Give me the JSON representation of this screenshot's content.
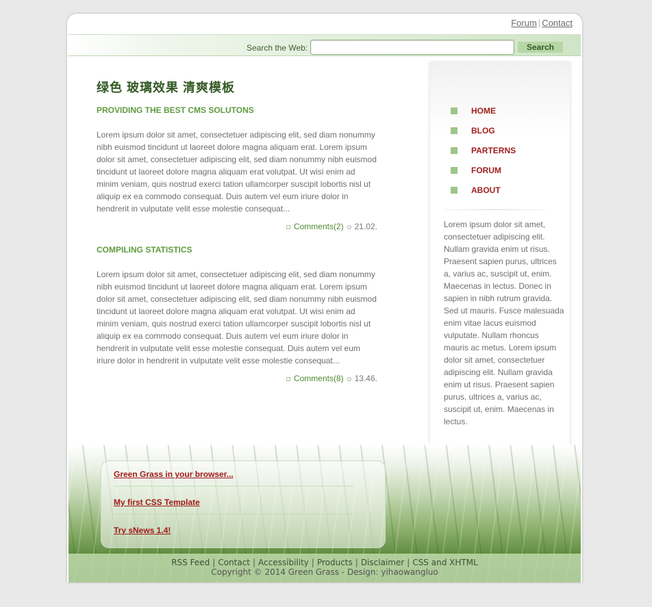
{
  "header": {
    "links": [
      {
        "label": "Forum"
      },
      {
        "label": "Contact"
      }
    ],
    "separator": "|",
    "search": {
      "label": "Search the Web:",
      "button": "Search",
      "value": ""
    }
  },
  "main": {
    "title": "绿色 玻璃效果 清爽模板",
    "posts": [
      {
        "title": "PROVIDING THE BEST CMS SOLUTONS",
        "body": "Lorem ipsum dolor sit amet, consectetuer adipiscing elit, sed diam nonummy nibh euismod tincidunt ut laoreet dolore magna aliquam erat. Lorem ipsum dolor sit amet, consectetuer adipiscing elit, sed diam nonummy nibh euismod tincidunt ut laoreet dolore magna aliquam erat volutpat. Ut wisi enim ad minim veniam, quis nostrud exerci tation ullamcorper suscipit lobortis nisl ut aliquip ex ea commodo consequat. Duis autem vel eum iriure dolor in hendrerit in vulputate velit esse molestie consequat...",
        "comments": "Comments(2)",
        "date": "21.02."
      },
      {
        "title": "COMPILING STATISTICS",
        "body": "Lorem ipsum dolor sit amet, consectetuer adipiscing elit, sed diam nonummy nibh euismod tincidunt ut laoreet dolore magna aliquam erat. Lorem ipsum dolor sit amet, consectetuer adipiscing elit, sed diam nonummy nibh euismod tincidunt ut laoreet dolore magna aliquam erat volutpat. Ut wisi enim ad minim veniam, quis nostrud exerci tation ullamcorper suscipit lobortis nisl ut aliquip ex ea commodo consequat. Duis autem vel eum iriure dolor in hendrerit in vulputate velit esse molestie consequat. Duis autem vel eum iriure dolor in hendrerit in vulputate velit esse molestie consequat...",
        "comments": "Comments(8)",
        "date": "13.46."
      }
    ]
  },
  "sidebar": {
    "nav": [
      {
        "label": "HOME"
      },
      {
        "label": "BLOG"
      },
      {
        "label": "PARTERNS"
      },
      {
        "label": "FORUM"
      },
      {
        "label": "ABOUT"
      }
    ],
    "text": "Lorem ipsum dolor sit amet, consectetuer adipiscing elit. Nullam gravida enim ut risus. Praesent sapien purus, ultrices a, varius ac, suscipit ut, enim. Maecenas in lectus. Donec in sapien in nibh rutrum gravida. Sed ut mauris. Fusce malesuada enim vitae lacus euismod vulputate. Nullam rhoncus mauris ac metus. Lorem ipsum dolor sit amet, consectetuer adipiscing elit. Nullam gravida enim ut risus. Praesent sapien purus, ultrices a, varius ac, suscipit ut, enim. Maecenas in lectus."
  },
  "box_links": [
    {
      "label": "Green Grass in your browser..."
    },
    {
      "label": "My first CSS Template"
    },
    {
      "label": "Try sNews 1.4!"
    }
  ],
  "footer": {
    "links": [
      {
        "label": "RSS Feed"
      },
      {
        "label": "Contact"
      },
      {
        "label": "Accessibility"
      },
      {
        "label": "Products"
      },
      {
        "label": "Disclaimer"
      },
      {
        "label": "CSS and XHTML"
      }
    ],
    "separator": "|",
    "copyright": "Copyright © 2014 Green Grass - Design: yihaowangluo"
  },
  "colors": {
    "accent_green": "#5f9b3e",
    "nav_red": "#a01f1f",
    "link_red": "#a11a1a"
  }
}
